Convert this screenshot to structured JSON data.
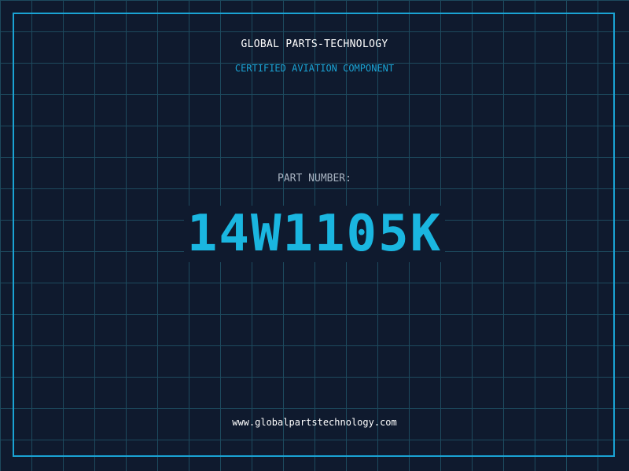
{
  "header": {
    "company": "GLOBAL PARTS-TECHNOLOGY",
    "subtitle": "CERTIFIED AVIATION COMPONENT"
  },
  "part": {
    "label": "PART NUMBER:",
    "number": "14W1105K"
  },
  "footer": {
    "url": "www.globalpartstechnology.com"
  },
  "colors": {
    "background": "#0f1a2e",
    "grid": "#1d4a5e",
    "accent": "#1aa3d4",
    "part_number": "#1ab6e0"
  }
}
